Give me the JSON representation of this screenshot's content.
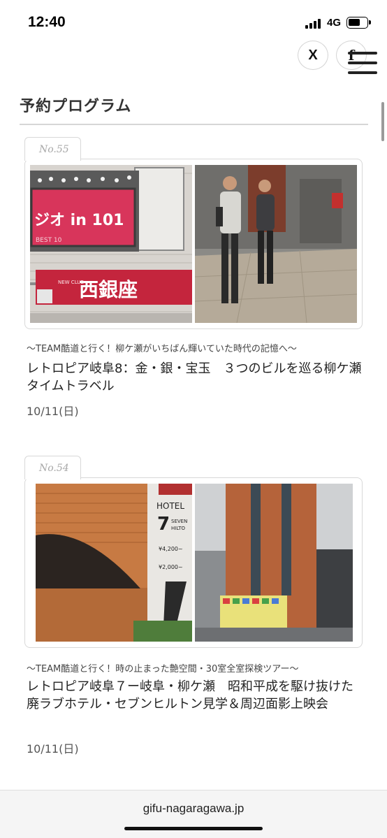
{
  "status_bar": {
    "time": "12:40",
    "network": "4G",
    "battery_level": 0.7,
    "signal_bars": 4
  },
  "share": {
    "x_icon": "X",
    "facebook_icon": "f"
  },
  "section": {
    "title": "予約プログラム"
  },
  "programs": [
    {
      "number": "No.55",
      "tagline": "〜TEAM酷道と行く！柳ケ瀬がいちばん輝いていた時代の記憶へ〜",
      "title": "レトロピア岐阜8：金・銀・宝玉　３つのビルを巡る柳ケ瀬タイムトラベル",
      "date": "10/11(日)",
      "photo_left": {
        "sign_top": "ジオ in 101",
        "sign_sub": "BEST 10",
        "sign_bottom": "西銀座",
        "sign_bottom_small": "NEW CLUB"
      }
    },
    {
      "number": "No.54",
      "tagline": "〜TEAM酷道と行く！時の止まった艶空間・30室全室探検ツアー〜",
      "title": "レトロピア岐阜７ー岐阜・柳ケ瀬　昭和平成を駆け抜けた廃ラブホテル・セブンヒルトン見学＆周辺面影上映会",
      "date": "10/11(日)",
      "photo_left": {
        "sign_hotel": "HOTEL",
        "sign_num": "7",
        "sign_name_1": "SEVEN",
        "sign_name_2": "HILTO",
        "rate_1": "¥4,200~",
        "rate_2": "¥2,000~"
      }
    }
  ],
  "url_bar": {
    "url": "gifu-nagaragawa.jp"
  }
}
